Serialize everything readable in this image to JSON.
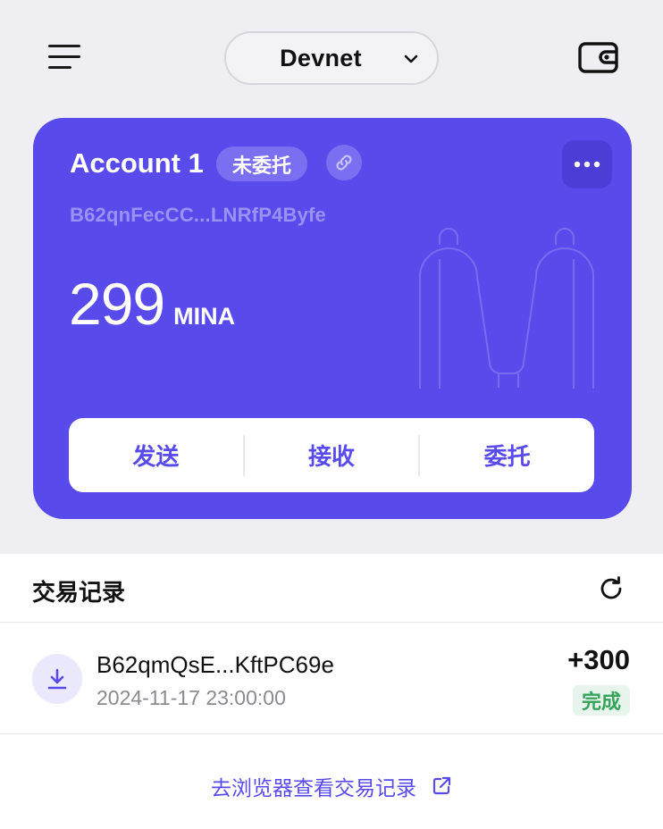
{
  "header": {
    "network": "Devnet"
  },
  "account": {
    "name": "Account 1",
    "delegation_badge": "未委托",
    "address": "B62qnFecCC...LNRfP4Byfe",
    "balance": "299",
    "unit": "MINA"
  },
  "actions": {
    "send": "发送",
    "receive": "接收",
    "delegate": "委托"
  },
  "transactions": {
    "title": "交易记录",
    "items": [
      {
        "address": "B62qmQsE...KftPC69e",
        "time": "2024-11-17 23:00:00",
        "amount": "+300",
        "status": "完成"
      }
    ],
    "explorer_link": "去浏览器查看交易记录"
  },
  "colors": {
    "accent": "#594beb",
    "success": "#35a35a",
    "background": "#efeff3"
  },
  "icons": [
    "menu-icon",
    "chevron-down-icon",
    "wallet-icon",
    "link-icon",
    "more-icon",
    "refresh-icon",
    "receive-icon",
    "external-link-icon"
  ]
}
